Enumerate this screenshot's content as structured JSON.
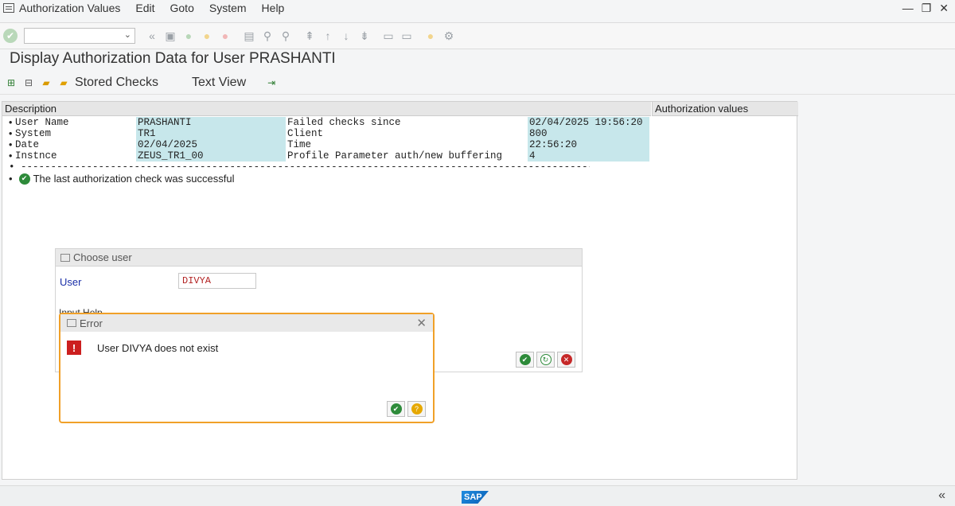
{
  "menubar": {
    "items": [
      "Authorization Values",
      "Edit",
      "Goto",
      "System",
      "Help"
    ]
  },
  "page_title": "Display Authorization Data for User PRASHANTI",
  "app_toolbar": {
    "stored_checks": "Stored Checks",
    "text_view": "Text View"
  },
  "table": {
    "col_description": "Description",
    "col_auth_values": "Authorization values",
    "rows": [
      {
        "label": "User Name",
        "value": "PRASHANTI",
        "label2": "Failed checks since",
        "value2": "02/04/2025 19:56:20"
      },
      {
        "label": "System",
        "value": "TR1",
        "label2": "Client",
        "value2": "800"
      },
      {
        "label": "Date",
        "value": "02/04/2025",
        "label2": "Time",
        "value2": "22:56:20"
      },
      {
        "label": "Instnce",
        "value": "ZEUS_TR1_00",
        "label2": "Profile Parameter auth/new buffering",
        "value2": "4"
      }
    ],
    "dashes": "-----------------------------------------------------------------------------------------------------",
    "success_message": "The last authorization check was successful"
  },
  "choose_user": {
    "title": "Choose user",
    "user_label": "User",
    "user_value": "DIVYA",
    "input_help": "Input Help"
  },
  "error_dialog": {
    "title": "Error",
    "message": "User DIVYA does not exist"
  },
  "colors": {
    "highlight": "#c7e7eb",
    "error_border": "#f0a028",
    "error_icon": "#cc1f1f",
    "success": "#2e8b3a"
  }
}
